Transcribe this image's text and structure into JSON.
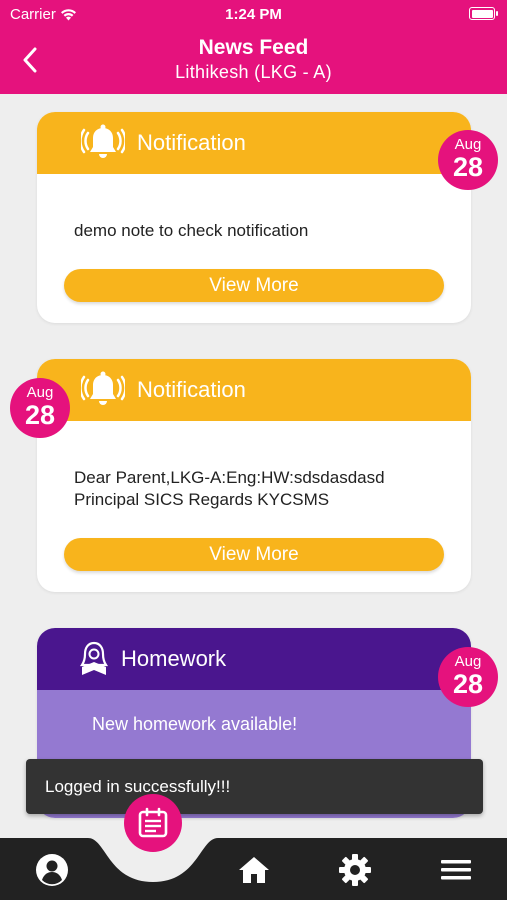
{
  "status_bar": {
    "carrier": "Carrier",
    "time": "1:24 PM"
  },
  "header": {
    "title": "News Feed",
    "subtitle": "Lithikesh (LKG - A)"
  },
  "feed": [
    {
      "type": "Notification",
      "month": "Aug",
      "day": "28",
      "message": "demo note to check notification",
      "button": "View More"
    },
    {
      "type": "Notification",
      "month": "Aug",
      "day": "28",
      "message_lines": [
        "Dear Parent,LKG-A:Eng:HW:sdsdasdasd",
        "Principal SICS Regards KYCSMS"
      ],
      "button": "View More"
    },
    {
      "type": "Homework",
      "month": "Aug",
      "day": "28",
      "message": "New homework available!"
    }
  ],
  "toast": "Logged in successfully!!!",
  "colors": {
    "primary": "#e5127d",
    "notification": "#f8b41c",
    "homework_header": "#4a168e",
    "homework_body": "#9479d1",
    "toast": "#333333",
    "nav": "#222222"
  },
  "bottom_nav": {
    "icons": [
      "profile-icon",
      "calendar-icon",
      "home-icon",
      "settings-icon",
      "menu-icon"
    ]
  }
}
